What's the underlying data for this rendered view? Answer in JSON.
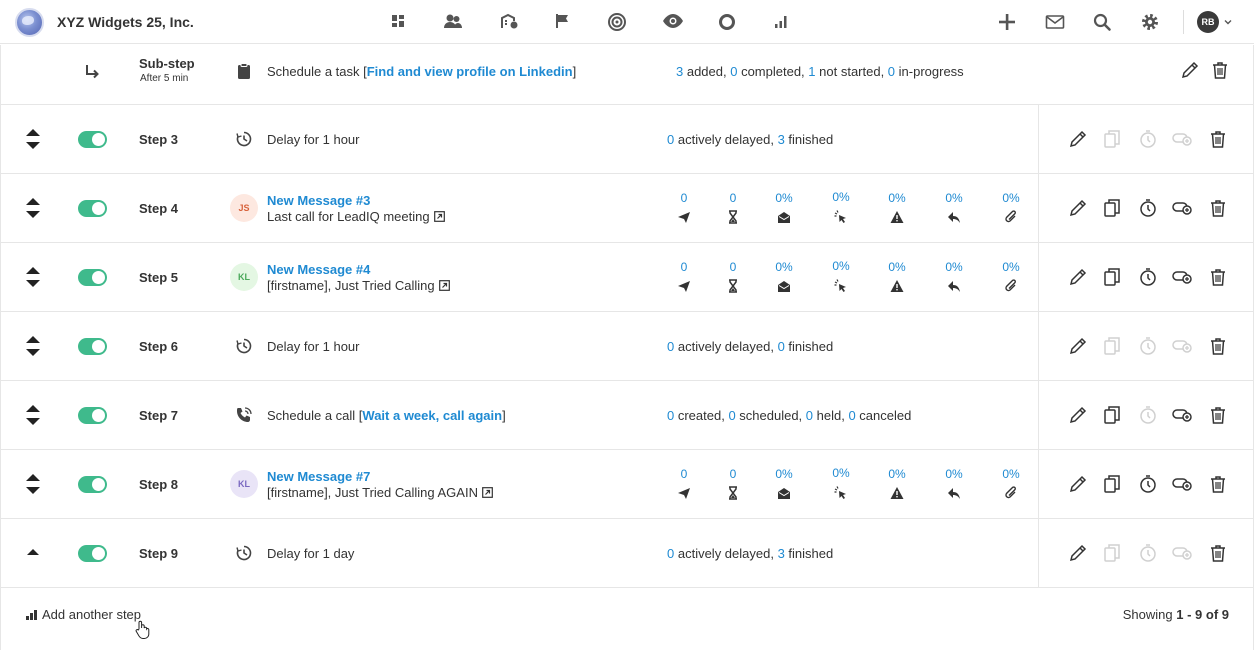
{
  "header": {
    "company": "XYZ Widgets 25, Inc.",
    "nav_icons": [
      "dashboard-icon",
      "people-icon",
      "companies-icon",
      "flag-icon",
      "target-icon",
      "eye-icon",
      "circle-icon",
      "bar-chart-icon"
    ],
    "right_icons": [
      "plus-icon",
      "mail-icon",
      "search-icon",
      "gear-icon"
    ],
    "user_initials": "RB"
  },
  "substep": {
    "title": "Sub-step",
    "delay": "After 5 min",
    "desc_prefix": "Schedule a task [",
    "task_link": "Find and view profile on Linkedin",
    "desc_suffix": "]",
    "added": "3",
    "added_label": " added, ",
    "completed": "0",
    "completed_label": " completed, ",
    "not_started": "1",
    "not_started_label": " not started, ",
    "in_progress": "0",
    "in_progress_label": " in-progress"
  },
  "steps": {
    "s3": {
      "label": "Step 3",
      "desc": "Delay for 1 hour",
      "delayed": "0",
      "delayed_label": " actively delayed, ",
      "finished": "3",
      "finished_label": " finished"
    },
    "s4": {
      "label": "Step 4",
      "avatar": "JS",
      "title": "New Message #3",
      "subtitle": "Last call for LeadIQ meeting",
      "metrics": [
        "0",
        "0",
        "0%",
        "0%",
        "0%",
        "0%",
        "0%"
      ]
    },
    "s5": {
      "label": "Step 5",
      "avatar": "KL",
      "title": "New Message #4",
      "subtitle": "[firstname], Just Tried Calling",
      "metrics": [
        "0",
        "0",
        "0%",
        "0%",
        "0%",
        "0%",
        "0%"
      ]
    },
    "s6": {
      "label": "Step 6",
      "desc": "Delay for 1 hour",
      "delayed": "0",
      "delayed_label": " actively delayed, ",
      "finished": "0",
      "finished_label": " finished"
    },
    "s7": {
      "label": "Step 7",
      "desc_prefix": "Schedule a call [",
      "call_link": "Wait a week, call again",
      "desc_suffix": "]",
      "created": "0",
      "created_label": " created, ",
      "scheduled": "0",
      "scheduled_label": " scheduled, ",
      "held": "0",
      "held_label": " held, ",
      "canceled": "0",
      "canceled_label": " canceled"
    },
    "s8": {
      "label": "Step 8",
      "avatar": "KL",
      "title": "New Message #7",
      "subtitle": "[firstname], Just Tried Calling AGAIN",
      "metrics": [
        "0",
        "0",
        "0%",
        "0%",
        "0%",
        "0%",
        "0%"
      ]
    },
    "s9": {
      "label": "Step 9",
      "desc": "Delay for 1 day",
      "delayed": "0",
      "delayed_label": " actively delayed, ",
      "finished": "3",
      "finished_label": " finished"
    }
  },
  "metric_icons": [
    "sent-icon",
    "pending-icon",
    "opened-icon",
    "clicked-icon",
    "bounced-icon",
    "replied-icon",
    "attachment-icon"
  ],
  "colors": {
    "accent": "#1f8ad2",
    "toggle_on": "#3fba8c",
    "border": "#e6e6e6"
  },
  "footer": {
    "add_step": "Add another step",
    "showing_prefix": "Showing ",
    "showing_range": "1 - 9 of 9"
  }
}
